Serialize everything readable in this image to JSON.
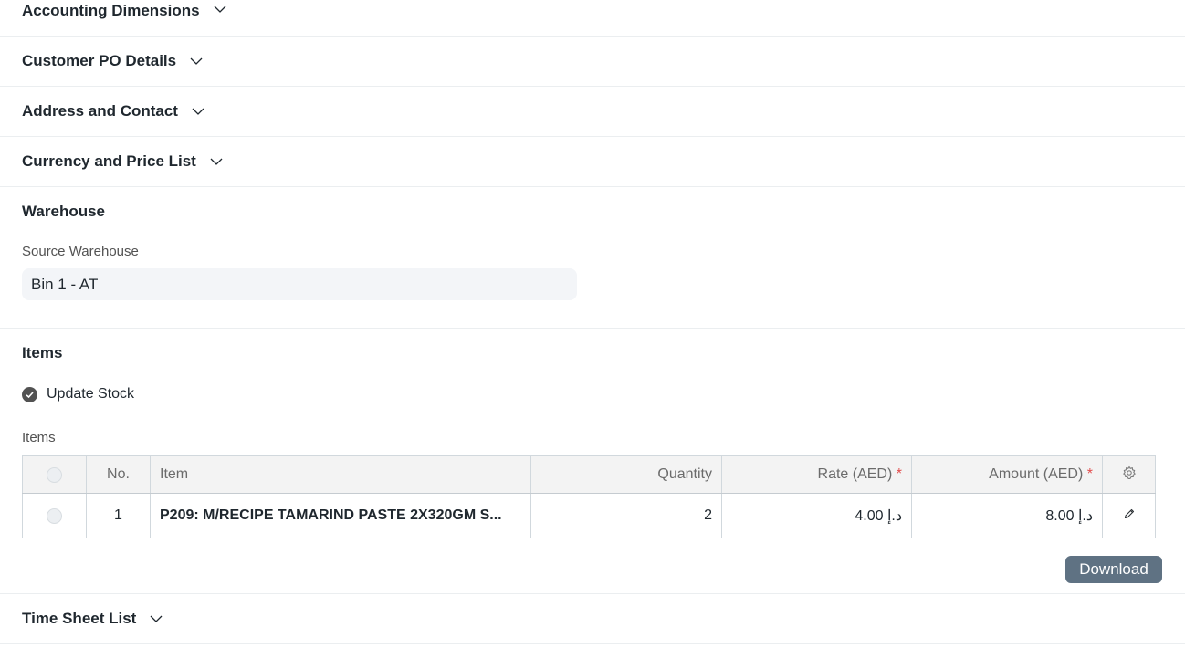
{
  "sections": {
    "accounting_dimensions": "Accounting Dimensions",
    "customer_po_details": "Customer PO Details",
    "address_and_contact": "Address and Contact",
    "currency_and_price_list": "Currency and Price List",
    "time_sheet_list": "Time Sheet List"
  },
  "warehouse": {
    "title": "Warehouse",
    "source_label": "Source Warehouse",
    "source_value": "Bin 1 - AT"
  },
  "items": {
    "title": "Items",
    "update_stock_label": "Update Stock",
    "table_label": "Items",
    "columns": {
      "no": "No.",
      "item": "Item",
      "quantity": "Quantity",
      "rate": "Rate (AED)",
      "amount": "Amount (AED)",
      "required_marker": "*"
    },
    "rows": [
      {
        "no": "1",
        "item": "P209: M/RECIPE TAMARIND PASTE 2X320GM S...",
        "quantity": "2",
        "rate": "4.00 د.إ",
        "amount": "8.00 د.إ"
      }
    ],
    "download_label": "Download"
  },
  "icons": {
    "chevron": "chevron-down-icon",
    "settings": "gear-icon",
    "edit": "pencil-icon",
    "check": "check-icon"
  },
  "colors": {
    "button_bg": "#5f7283",
    "required": "#e24c4c",
    "input_bg": "#f3f5f8"
  }
}
